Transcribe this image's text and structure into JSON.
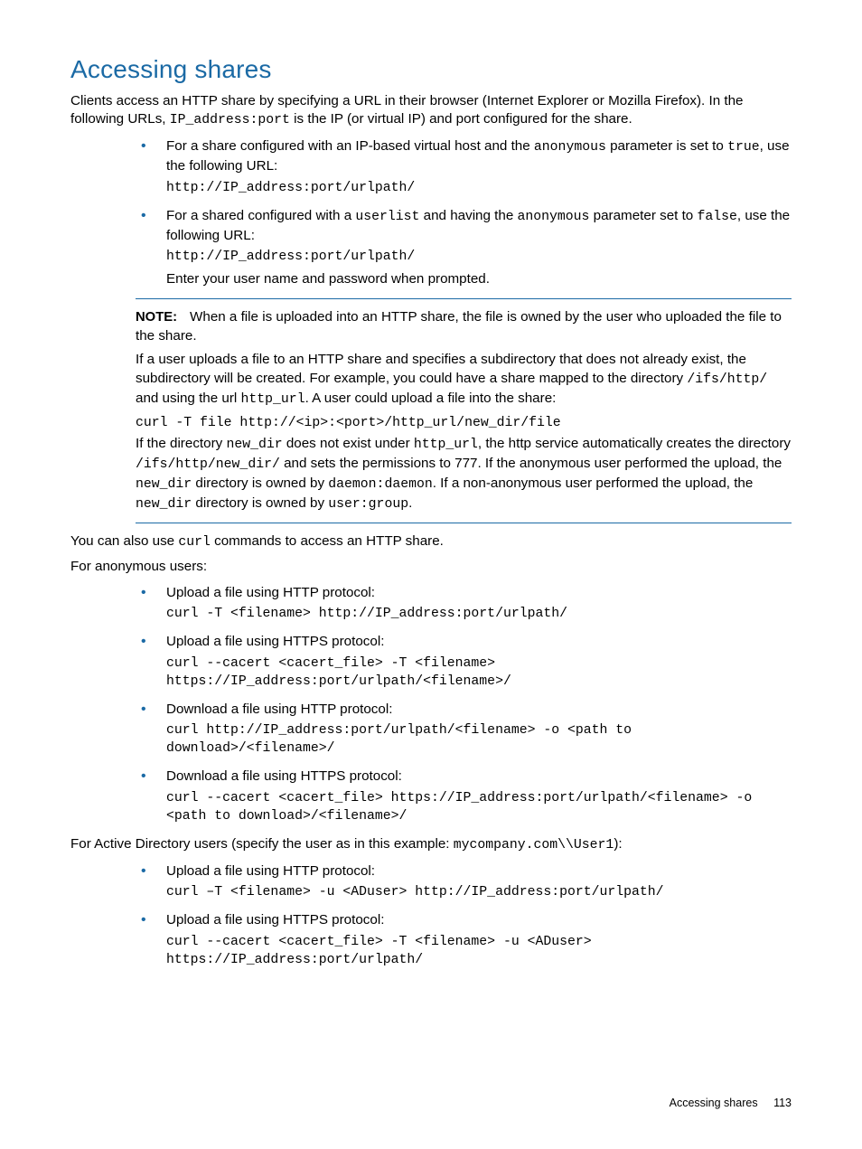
{
  "title": "Accessing shares",
  "intro": {
    "pre": "Clients access an HTTP share by specifying a URL in their browser (Internet Explorer or Mozilla Firefox). In the following URLs, ",
    "mono1": "IP_address:port",
    "post": " is the IP (or virtual IP) and port configured for the share."
  },
  "list1": {
    "a": {
      "pre": "For a share configured with an IP-based virtual host and the ",
      "m1": "anonymous",
      "mid": " parameter is set to ",
      "m2": "true",
      "post": ", use the following URL:",
      "code": "http://IP_address:port/urlpath/"
    },
    "b": {
      "pre": "For a shared configured with a ",
      "m1": "userlist",
      "mid": " and having the ",
      "m2": "anonymous",
      "post": " parameter set to ",
      "m3": "false",
      "tail": ", use the following URL:",
      "code": "http://IP_address:port/urlpath/",
      "after": "Enter your user name and password when prompted."
    }
  },
  "note": {
    "label": "NOTE:",
    "p1": "When a file is uploaded into an HTTP share, the file is owned by the user who uploaded the file to the share.",
    "p2_pre": "If a user uploads a file to an HTTP share and specifies a subdirectory that does not already exist, the subdirectory will be created. For example, you could have a share mapped to the directory ",
    "p2_m1": "/ifs/http/",
    "p2_mid1": " and using the url ",
    "p2_m2": "http_url",
    "p2_tail": ". A user could upload a file into the share:",
    "code": "curl -T file http://<ip>:<port>/http_url/new_dir/file",
    "p3_pre": "If the directory ",
    "p3_m1": "new_dir",
    "p3_mid1": " does not exist under ",
    "p3_m2": "http_url",
    "p3_mid2": ", the http service automatically creates the directory ",
    "p3_m3": "/ifs/http/new_dir/",
    "p3_mid3": " and sets the permissions to 777. If the anonymous user performed the upload, the ",
    "p3_m4": "new_dir",
    "p3_mid4": " directory is owned by ",
    "p3_m5": "daemon:daemon",
    "p3_mid5": ". If a non-anonymous user performed the upload, the ",
    "p3_m6": "new_dir",
    "p3_mid6": " directory is owned by ",
    "p3_m7": "user:group",
    "p3_tail": "."
  },
  "after_note": {
    "p1_pre": "You can also use ",
    "p1_m1": "curl",
    "p1_post": " commands to access an HTTP share.",
    "p2": "For anonymous users:"
  },
  "list2": {
    "a": {
      "t": "Upload a file using HTTP protocol:",
      "c": "curl -T <filename> http://IP_address:port/urlpath/"
    },
    "b": {
      "t": "Upload a file using HTTPS protocol:",
      "c": "curl --cacert <cacert_file> -T <filename> https://IP_address:port/urlpath/<filename>/"
    },
    "c": {
      "t": "Download a file using HTTP protocol:",
      "c": "curl http://IP_address:port/urlpath/<filename> -o <path to download>/<filename>/"
    },
    "d": {
      "t": "Download a file using HTTPS protocol:",
      "c": "curl --cacert <cacert_file> https://IP_address:port/urlpath/<filename> -o <path to download>/<filename>/"
    }
  },
  "ad_intro": {
    "pre": "For Active Directory users (specify the user as in this example: ",
    "m1": "mycompany.com\\\\User1",
    "post": "):"
  },
  "list3": {
    "a": {
      "t": "Upload a file using HTTP protocol:",
      "c": "curl –T <filename> -u <ADuser> http://IP_address:port/urlpath/"
    },
    "b": {
      "t": "Upload a file using HTTPS protocol:",
      "c": "curl --cacert <cacert_file> -T <filename> -u <ADuser> https://IP_address:port/urlpath/"
    }
  },
  "footer": {
    "label": "Accessing shares",
    "page": "113"
  }
}
